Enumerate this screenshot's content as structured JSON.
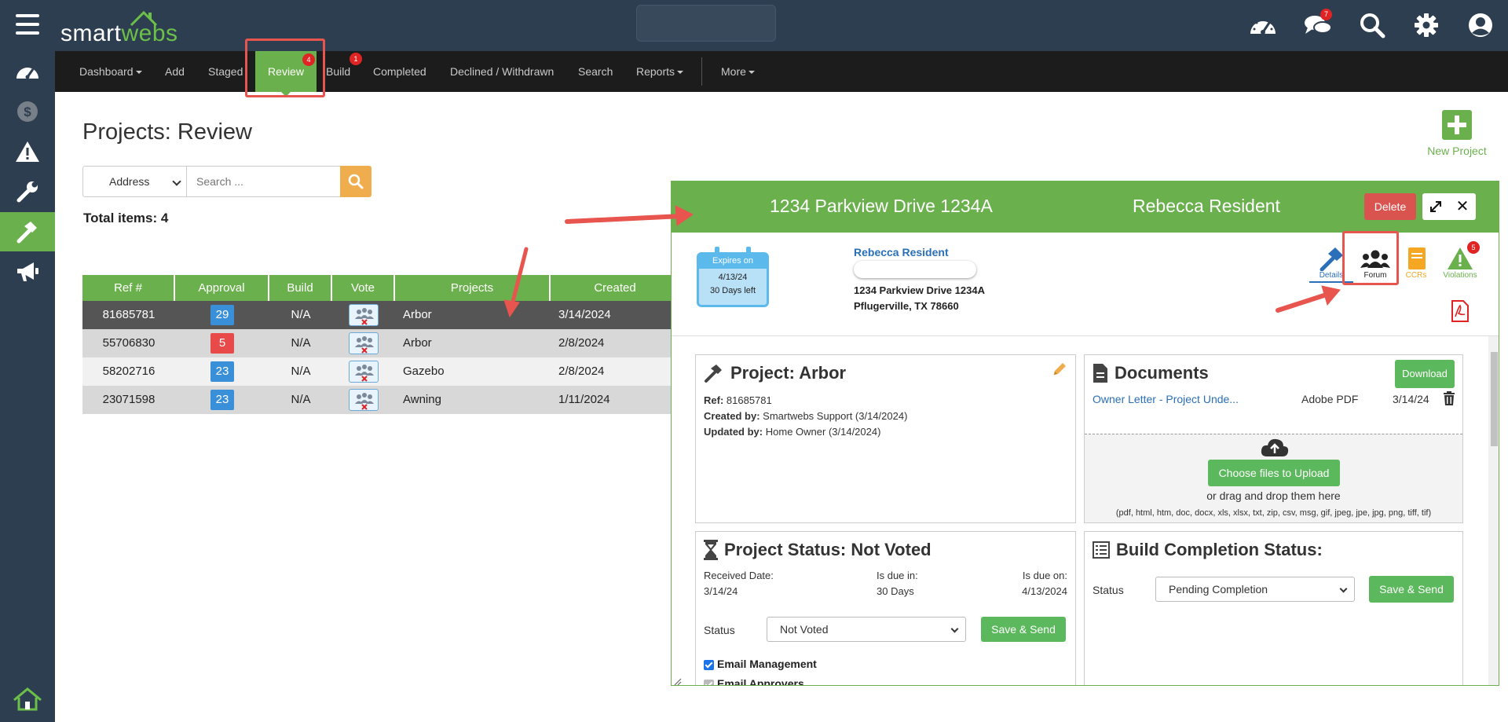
{
  "header": {
    "logo_left": "smart",
    "logo_right": "webs",
    "chat_badge": "7"
  },
  "nav": {
    "dashboard": "Dashboard",
    "add": "Add",
    "staged": "Staged",
    "review": "Review",
    "review_badge": "4",
    "build": "Build",
    "build_badge": "1",
    "completed": "Completed",
    "declined": "Declined / Withdrawn",
    "search": "Search",
    "reports": "Reports",
    "more": "More"
  },
  "page": {
    "title": "Projects: Review",
    "new_project": "New Project",
    "search_field": "Address",
    "search_placeholder": "Search ...",
    "total_items": "Total items: 4"
  },
  "table": {
    "headers": [
      "Ref #",
      "Approval",
      "Build",
      "Vote",
      "Projects",
      "Created"
    ],
    "rows": [
      {
        "ref": "81685781",
        "approval": "29",
        "approval_color": "#3a8fd9",
        "build": "N/A",
        "project": "Arbor",
        "created": "3/14/2024"
      },
      {
        "ref": "55706830",
        "approval": "5",
        "approval_color": "#e84a4a",
        "build": "N/A",
        "project": "Arbor",
        "created": "2/8/2024"
      },
      {
        "ref": "58202716",
        "approval": "23",
        "approval_color": "#3a8fd9",
        "build": "N/A",
        "project": "Gazebo",
        "created": "2/8/2024"
      },
      {
        "ref": "23071598",
        "approval": "23",
        "approval_color": "#3a8fd9",
        "build": "N/A",
        "project": "Awning",
        "created": "1/11/2024"
      }
    ]
  },
  "panel": {
    "address": "1234 Parkview Drive 1234A",
    "resident": "Rebecca Resident",
    "delete": "Delete",
    "calendar": {
      "header": "Expires on",
      "date": "4/13/24",
      "left": "30 Days left"
    },
    "resident_link": "Rebecca Resident",
    "addr_line1": "1234 Parkview Drive 1234A",
    "addr_line2": "Pflugerville, TX 78660",
    "tabs": {
      "details": "Details",
      "forum": "Forum",
      "ccrs": "CCRs",
      "violations": "Violations",
      "violations_badge": "5"
    },
    "project": {
      "title": "Project: Arbor",
      "ref_label": "Ref:",
      "ref": "81685781",
      "created_label": "Created by:",
      "created": "Smartwebs Support (3/14/2024)",
      "updated_label": "Updated by:",
      "updated": "Home Owner (3/14/2024)"
    },
    "documents": {
      "title": "Documents",
      "download": "Download",
      "doc_name": "Owner Letter - Project Unde...",
      "doc_type": "Adobe PDF",
      "doc_date": "3/14/24",
      "upload_btn": "Choose files to Upload",
      "drag_text": "or drag and drop them here",
      "formats": "(pdf, html, htm, doc, docx, xls, xlsx, txt, zip, csv, msg, gif, jpeg, jpe, jpg, png, tiff, tif)"
    },
    "status": {
      "title": "Project Status: Not Voted",
      "received_label": "Received Date:",
      "received": "3/14/24",
      "due_in_label": "Is due in:",
      "due_in": "30 Days",
      "due_on_label": "Is due on:",
      "due_on": "4/13/2024",
      "status_label": "Status",
      "status_value": "Not Voted",
      "save": "Save & Send",
      "email_mgmt": "Email Management",
      "email_appr": "Email Approvers"
    },
    "build": {
      "title": "Build Completion Status:",
      "status_label": "Status",
      "status_value": "Pending Completion",
      "save": "Save & Send"
    }
  },
  "colors": {
    "brand_green": "#6ab04c",
    "header_dark": "#2d3e50",
    "nav_dark": "#1c1c1c",
    "badge_red": "#e02424",
    "annotation_red": "#e8554e"
  }
}
